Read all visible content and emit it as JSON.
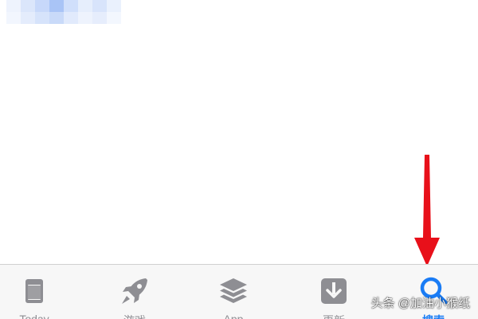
{
  "colors": {
    "tab_inactive": "#8e8e93",
    "tab_active": "#1a7cf5",
    "annotation_arrow": "#e8101a",
    "tabbar_bg": "#f7f7f7"
  },
  "top_placeholder": {
    "description_icon": "pixelated-mosaic"
  },
  "tabbar": {
    "tabs": [
      {
        "label": "Today",
        "icon": "today-icon",
        "active": false
      },
      {
        "label": "游戏",
        "icon": "rocket-icon",
        "active": false
      },
      {
        "label": "App",
        "icon": "layers-icon",
        "active": false
      },
      {
        "label": "更新",
        "icon": "download-icon",
        "active": false
      },
      {
        "label": "搜索",
        "icon": "search-icon",
        "active": true
      }
    ]
  },
  "watermark": {
    "text": "头条 @加油小猴纸"
  }
}
